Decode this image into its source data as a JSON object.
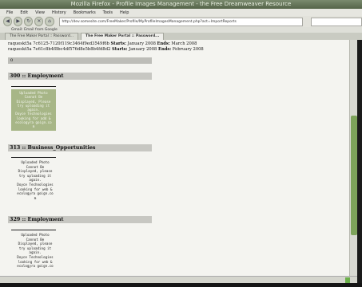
{
  "window": {
    "title": "Mozilla Firefox - Profile Images Management - the Free Dreamweaver Resource"
  },
  "menu": {
    "items": [
      "File",
      "Edit",
      "View",
      "History",
      "Bookmarks",
      "Tools",
      "Help"
    ]
  },
  "nav": {
    "back": "◀",
    "forward": "▶",
    "reload": "↻",
    "stop": "✕",
    "home": "⌂",
    "url": "http://dev.somesite.com/FreeMaker/Profile/MyProfileImagesManagement.php?act=ImportReports"
  },
  "bookmarks_bar": {
    "label": "Gmail: Email from Google"
  },
  "tabs": [
    {
      "label": "The Free Maker Portal :: Password..."
    },
    {
      "label": "The Free Maker Portal :: Password..."
    }
  ],
  "content": {
    "ip_lines": [
      {
        "id": "raqueskt5a 7c6125-7120f119c3464f9ed3549f6b",
        "start_label": "Starts:",
        "start": "January 2008",
        "end_label": "Ends:",
        "end": "March 2008"
      },
      {
        "id": "raqueskt5a 7e61c8b4f8bc4df576d8e5b8b4fd8d2",
        "start_label": "Starts:",
        "start": "January 2008",
        "end_label": "Ends:",
        "end": "February 2008"
      }
    ],
    "small_bar_text": "0",
    "sections": [
      {
        "heading": "300 :: Employment",
        "style": "image",
        "lines": [
          "Uploaded Photo",
          "Cannot Be",
          "Displayed, Please",
          "try uploading it",
          "again.",
          "Doyce Technologies",
          "looking for add &",
          "ecologyra goign.co",
          "m"
        ]
      },
      {
        "heading": "313 :: Business_Opportunities",
        "style": "text",
        "lines": [
          "Uploaded Photo",
          "Cannot Be",
          "Displayed, please",
          "try uploading it",
          "again.",
          "Doyce Technologies",
          "looking for web &",
          "ecologyra goign.co",
          "m"
        ]
      },
      {
        "heading": "329 :: Employment",
        "style": "text",
        "lines": [
          "Uploaded Photo",
          "Cannot Be",
          "Displayed, please",
          "try uploading it",
          "again.",
          "Doyce Technologies",
          "looking for web &",
          "ecologyra goign.co"
        ]
      }
    ]
  },
  "colors": {
    "image_block": "#9fb07c",
    "heading_bg": "#c7c7c2",
    "scroll_thumb": "#7da35a"
  }
}
